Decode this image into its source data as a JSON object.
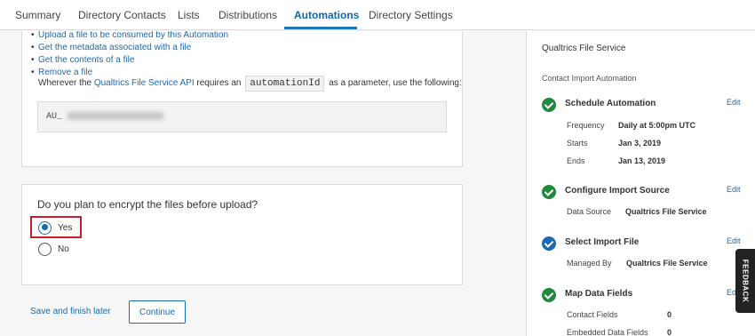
{
  "nav": {
    "tabs": [
      {
        "label": "Summary"
      },
      {
        "label": "Directory Contacts"
      },
      {
        "label": "Lists"
      },
      {
        "label": "Distributions"
      },
      {
        "label": "Automations"
      },
      {
        "label": "Directory Settings"
      }
    ],
    "active_tab": "Automations"
  },
  "api_links": [
    "Upload a file to be consumed by this Automation",
    "Get the metadata associated with a file",
    "Get the contents of a file",
    "Remove a file"
  ],
  "api_note": {
    "prefix": "Wherever the",
    "link": "Qualtrics File Service API",
    "middle": "requires an",
    "code": "automationId",
    "suffix": "as a parameter, use the following:"
  },
  "automation_id_prefix": "AU_",
  "encrypt_question": {
    "question": "Do you plan to encrypt the files before upload?",
    "options": [
      "Yes",
      "No"
    ],
    "selected": "Yes"
  },
  "actions": {
    "save_label": "Save and finish later",
    "continue_label": "Continue"
  },
  "summary_panel": {
    "title": "Qualtrics File Service",
    "subtitle": "Contact Import Automation",
    "edit_label": "Edit",
    "steps": [
      {
        "title": "Schedule Automation",
        "status": "complete",
        "fields": [
          {
            "label": "Frequency",
            "value": "Daily at 5:00pm UTC"
          },
          {
            "label": "Starts",
            "value": "Jan 3, 2019"
          },
          {
            "label": "Ends",
            "value": "Jan 13, 2019"
          }
        ]
      },
      {
        "title": "Configure Import Source",
        "status": "complete",
        "fields": [
          {
            "label": "Data Source",
            "value": "Qualtrics File Service"
          }
        ]
      },
      {
        "title": "Select Import File",
        "status": "current",
        "fields": [
          {
            "label": "Managed By",
            "value": "Qualtrics File Service"
          }
        ]
      },
      {
        "title": "Map Data Fields",
        "status": "complete",
        "fields": [
          {
            "label": "Contact Fields",
            "value": "0"
          },
          {
            "label": "Embedded Data Fields",
            "value": "0"
          }
        ]
      }
    ]
  },
  "feedback_label": "FEEDBACK",
  "colors": {
    "accent": "#1a6ab0",
    "success": "#1f8a3c",
    "highlight": "#c81e2a"
  }
}
